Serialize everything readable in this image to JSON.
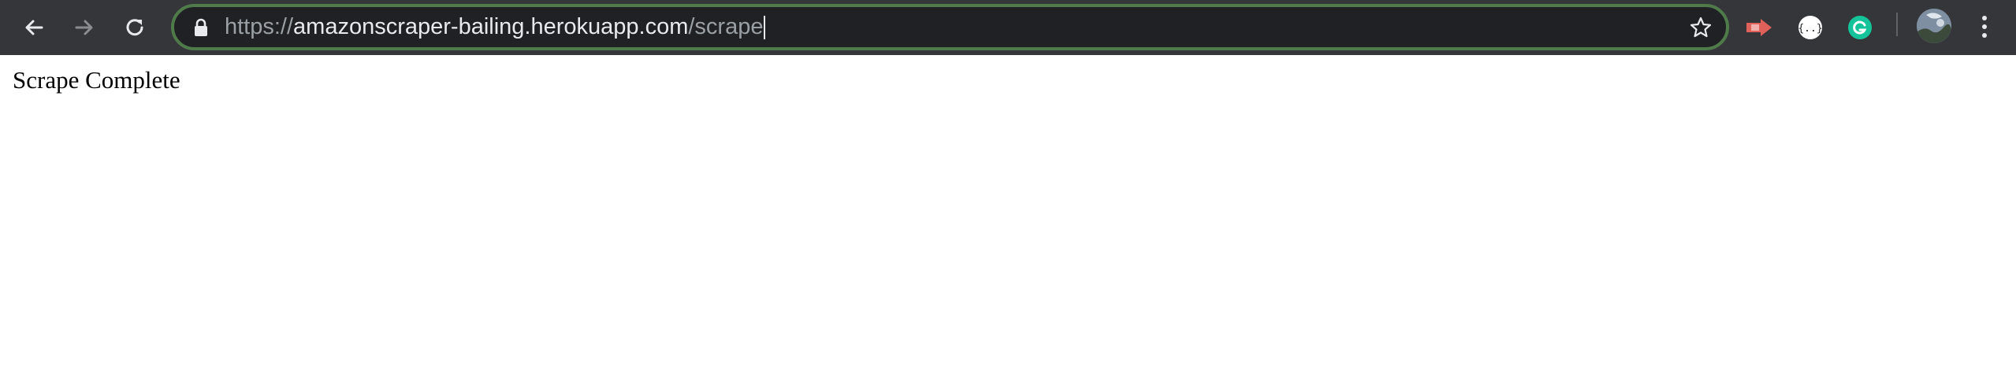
{
  "browser": {
    "address_bar": {
      "url_scheme": "https://",
      "url_host": "amazonscraper-bailing.herokuapp.com",
      "url_path": "/scrape"
    }
  },
  "icons": {
    "back": "arrow-left",
    "forward": "arrow-right",
    "reload": "reload",
    "lock": "lock",
    "bookmark": "star",
    "menu": "vertical-dots"
  },
  "colors": {
    "toolbar_bg": "#35363a",
    "omnibox_bg": "#202124",
    "omnibox_focus_border": "#4f7a4a",
    "page_bg": "#ffffff"
  },
  "page": {
    "body_text": "Scrape Complete"
  }
}
